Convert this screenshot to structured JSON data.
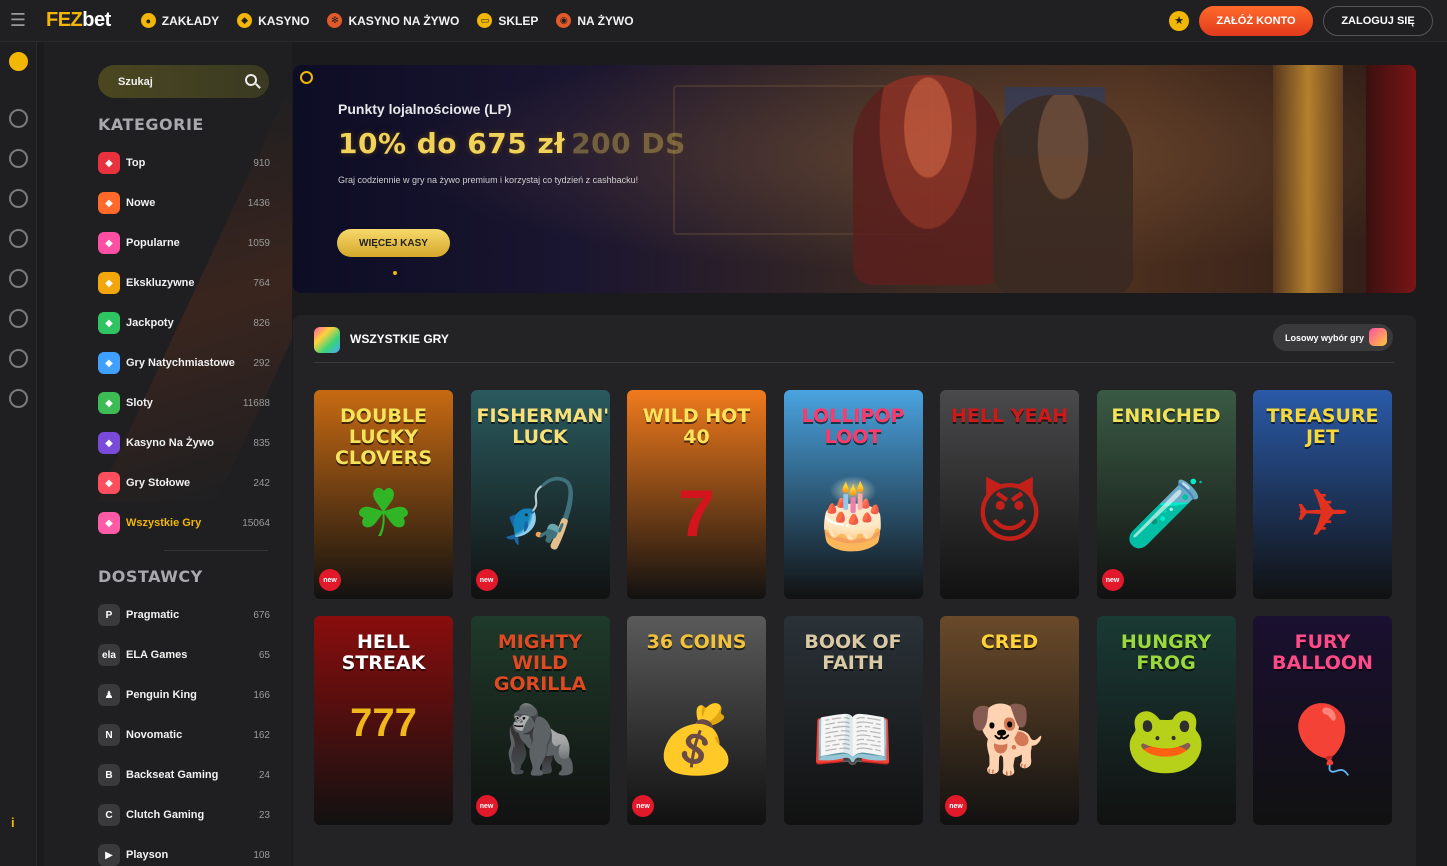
{
  "header": {
    "logo_fez": "FEZ",
    "logo_bet": "bet",
    "nav": [
      {
        "label": "ZAKŁADY",
        "icon": "soccer-ball-icon"
      },
      {
        "label": "KASYNO",
        "icon": "casino-chip-icon"
      },
      {
        "label": "KASYNO NA ŻYWO",
        "icon": "live-casino-icon"
      },
      {
        "label": "SKLEP",
        "icon": "shop-icon"
      },
      {
        "label": "NA ŻYWO",
        "icon": "live-signal-icon"
      }
    ],
    "register_label": "ZAŁÓŻ KONTO",
    "login_label": "ZALOGUJ SIĘ"
  },
  "rail": {
    "info_label": "i"
  },
  "sidebar": {
    "search_placeholder": "Szukaj",
    "categories_title": "KATEGORIE",
    "categories": [
      {
        "label": "Top",
        "count": "910",
        "color": "#e8333f"
      },
      {
        "label": "Nowe",
        "count": "1436",
        "color": "#ff6a2b"
      },
      {
        "label": "Popularne",
        "count": "1059",
        "color": "#ff4fa3"
      },
      {
        "label": "Ekskluzywne",
        "count": "764",
        "color": "#f2a60c"
      },
      {
        "label": "Jackpoty",
        "count": "826",
        "color": "#2fc461"
      },
      {
        "label": "Gry Natychmiastowe",
        "count": "292",
        "color": "#3fa0ff"
      },
      {
        "label": "Sloty",
        "count": "11688",
        "color": "#3dbb55"
      },
      {
        "label": "Kasyno Na Żywo",
        "count": "835",
        "color": "#7a4ad8"
      },
      {
        "label": "Gry Stołowe",
        "count": "242",
        "color": "#ff4f5e"
      },
      {
        "label": "Wszystkie Gry",
        "count": "15064",
        "color": "#ff5aa5"
      }
    ],
    "providers_title": "DOSTAWCY",
    "providers": [
      {
        "label": "Pragmatic",
        "count": "676",
        "glyph": "P"
      },
      {
        "label": "ELA Games",
        "count": "65",
        "glyph": "ela"
      },
      {
        "label": "Penguin King",
        "count": "166",
        "glyph": "♟"
      },
      {
        "label": "Novomatic",
        "count": "162",
        "glyph": "N"
      },
      {
        "label": "Backseat Gaming",
        "count": "24",
        "glyph": "B"
      },
      {
        "label": "Clutch Gaming",
        "count": "23",
        "glyph": "C"
      },
      {
        "label": "Playson",
        "count": "108",
        "glyph": "▶"
      }
    ]
  },
  "banner": {
    "subtitle": "Punkty lojalnościowe (LP)",
    "title": "10% do 675 zł",
    "title_ghost": "200 DS",
    "description": "Graj codziennie w gry na żywo premium i korzystaj co tydzień z cashbacku!",
    "button_label": "WIĘCEJ KASY"
  },
  "games_panel": {
    "title": "WSZYSTKIE GRY",
    "random_label": "Losowy wybór gry",
    "new_badge": "new",
    "games": [
      {
        "title": "DOUBLE LUCKY CLOVERS",
        "bg": "#c76a12",
        "fg": "#f5e45b",
        "art": "☘",
        "art_color": "#2fb526",
        "new": true
      },
      {
        "title": "FISHERMAN'S LUCK",
        "bg": "#2a5a5e",
        "fg": "#f7e07a",
        "art": "🎣",
        "art_color": "#f0a030",
        "new": true
      },
      {
        "title": "WILD HOT 40",
        "bg": "#f07a1c",
        "fg": "#ffe35a",
        "art": "7",
        "art_color": "#d3141c",
        "new": false
      },
      {
        "title": "LOLLIPOP LOOT",
        "bg": "#4aa3e0",
        "fg": "#ff3a6a",
        "art": "🎂",
        "art_color": "#ff8ad0",
        "new": false
      },
      {
        "title": "HELL YEAH",
        "bg": "#4a4a4c",
        "fg": "#d01818",
        "art": "😈",
        "art_color": "#c4201a",
        "new": false
      },
      {
        "title": "ENRICHED",
        "bg": "#3a5a44",
        "fg": "#f2e25a",
        "art": "🧪",
        "art_color": "#e8c08a",
        "new": true
      },
      {
        "title": "TREASURE JET",
        "bg": "#2a5aa8",
        "fg": "#f7d83b",
        "art": "✈",
        "art_color": "#e2311f",
        "new": false
      },
      {
        "title": "HELL STREAK",
        "bg": "#8a0d0d",
        "fg": "#ffffff",
        "art": "777",
        "art_color": "#f0b81a",
        "new": false
      },
      {
        "title": "MIGHTY WILD GORILLA",
        "bg": "#1f3a2a",
        "fg": "#e04a22",
        "art": "🦍",
        "art_color": "#3a3a3a",
        "new": true
      },
      {
        "title": "36 COINS",
        "bg": "#5a5a5a",
        "fg": "#f2c23a",
        "art": "💰",
        "art_color": "#f0c23a",
        "new": true
      },
      {
        "title": "BOOK OF FAITH",
        "bg": "#2a3238",
        "fg": "#d9c9a5",
        "art": "📖",
        "art_color": "#b0884a",
        "new": false
      },
      {
        "title": "CRED",
        "bg": "#6a4a2a",
        "fg": "#ffd23a",
        "art": "🐕",
        "art_color": "#b06a2a",
        "new": true
      },
      {
        "title": "HUNGRY FROG",
        "bg": "#1a3a34",
        "fg": "#9ad83b",
        "art": "🐸",
        "art_color": "#2a6ae0",
        "new": false
      },
      {
        "title": "FURY BALLOON",
        "bg": "#1a1030",
        "fg": "#ff4a8a",
        "art": "🎈",
        "art_color": "#e0308a",
        "new": false
      }
    ]
  }
}
